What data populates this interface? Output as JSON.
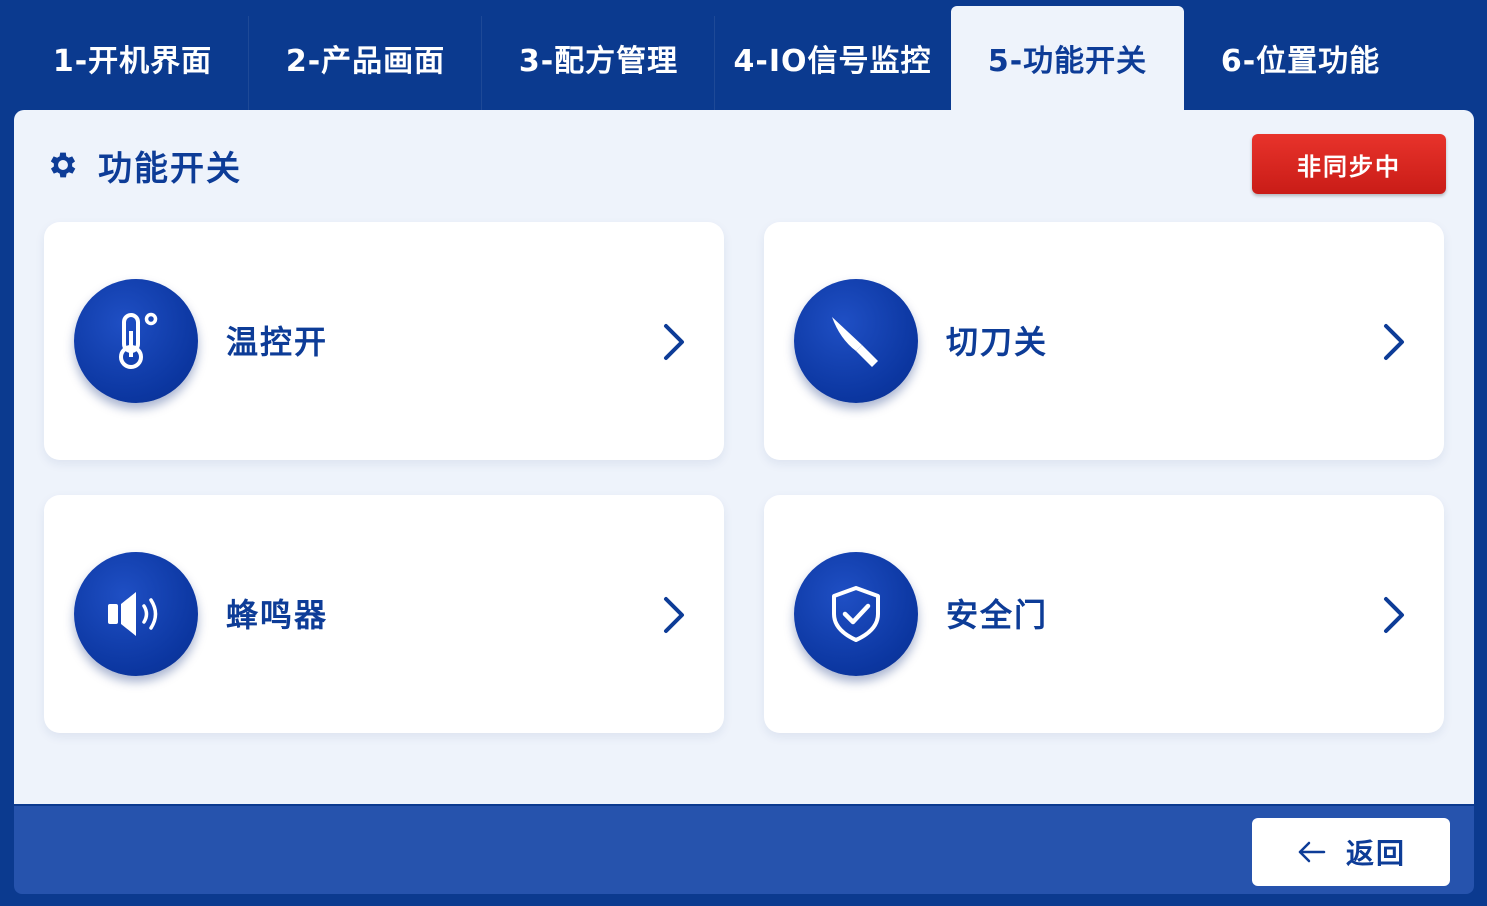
{
  "tabs": [
    {
      "label": "1-开机界面",
      "active": false
    },
    {
      "label": "2-产品画面",
      "active": false
    },
    {
      "label": "3-配方管理",
      "active": false
    },
    {
      "label": "4-IO信号监控",
      "active": false
    },
    {
      "label": "5-功能开关",
      "active": true
    },
    {
      "label": "6-位置功能",
      "active": false
    }
  ],
  "panel": {
    "title": "功能开关",
    "title_icon": "gear-icon",
    "sync_button": "非同步中"
  },
  "cards": [
    {
      "label": "温控开",
      "icon": "thermometer-icon"
    },
    {
      "label": "切刀关",
      "icon": "knife-icon"
    },
    {
      "label": "蜂鸣器",
      "icon": "speaker-icon"
    },
    {
      "label": "安全门",
      "icon": "shield-check-icon"
    }
  ],
  "footer": {
    "back_button": "返回",
    "back_icon": "arrow-left-icon"
  },
  "colors": {
    "navy": "#0b3a8f",
    "panel_bg": "#eef3fb",
    "accent_text": "#0d3c97",
    "footer_bar": "#2653ad",
    "alert_red": "#e0261f"
  }
}
